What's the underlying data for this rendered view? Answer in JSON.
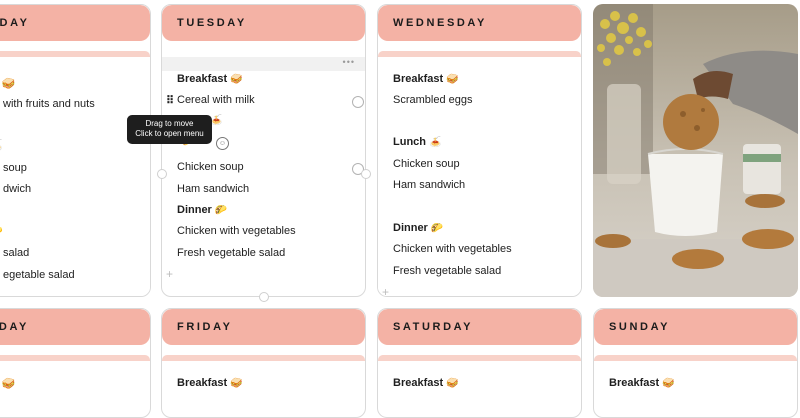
{
  "cards": {
    "monday": {
      "day": "NDAY",
      "lines": [
        "st 🥪",
        "with fruits and nuts",
        "🍝",
        "soup",
        "dwich",
        "🌮",
        "salad",
        "egetable salad"
      ]
    },
    "tuesday": {
      "day": "TUESDAY",
      "breakfast": "Breakfast",
      "breakfast_item": "Cereal with milk",
      "lunch_item_1": "Chicken soup",
      "lunch_item_2": "Ham sandwich",
      "dinner": "Dinner",
      "dinner_item_1": "Chicken with vegetables",
      "dinner_item_2": "Fresh vegetable salad"
    },
    "wednesday": {
      "day": "WEDNESDAY",
      "breakfast": "Breakfast",
      "breakfast_item": "Scrambled eggs",
      "lunch": "Lunch",
      "lunch_item_1": "Chicken soup",
      "lunch_item_2": "Ham sandwich",
      "dinner": "Dinner",
      "dinner_item_1": "Chicken with vegetables",
      "dinner_item_2": "Fresh vegetable salad"
    },
    "thursday": {
      "day": "SDAY",
      "line1": "st 🥪"
    },
    "friday": {
      "day": "FRIDAY",
      "breakfast": "Breakfast"
    },
    "saturday": {
      "day": "SATURDAY",
      "breakfast": "Breakfast"
    },
    "sunday": {
      "day": "SUNDAY",
      "breakfast": "Breakfast"
    }
  },
  "emoji": {
    "breakfast": "🥪",
    "lunch": "🍝",
    "dinner": "🌮"
  },
  "tooltip": {
    "line1": "Drag to move",
    "line2": "Click to open menu"
  },
  "block_menu_dots": "•••",
  "colors": {
    "header": "#f4b2a5",
    "strip": "#f8d2c9",
    "border": "#d9d9d9"
  }
}
